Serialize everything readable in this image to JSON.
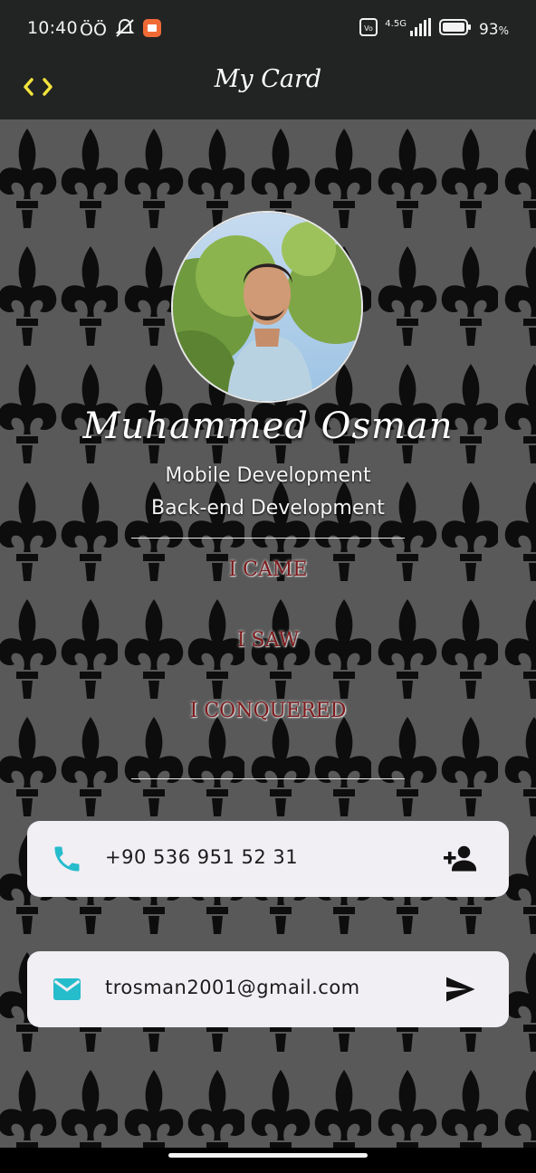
{
  "status_bar": {
    "time": "10:40",
    "left_glyphs": "ÖÖ",
    "network": "4.5G",
    "battery_percent": "93",
    "battery_unit": "%",
    "icons": [
      "mute-bell-icon",
      "app-notification-icon",
      "volte-icon",
      "signal-icon",
      "battery-icon"
    ]
  },
  "app_bar": {
    "title": "My Card",
    "code_icon": "code-icon",
    "code_icon_color": "#f2e33c"
  },
  "profile": {
    "name": "Muhammed Osman",
    "roles": [
      "Mobile Development",
      "Back-end Development"
    ]
  },
  "motto": [
    "I CAME",
    "I SAW",
    "I CONQUERED"
  ],
  "contacts": {
    "phone": {
      "icon": "phone-icon",
      "value": "+90 536 951 52 31",
      "action_icon": "add-person-icon"
    },
    "email": {
      "icon": "mail-icon",
      "value": "trosman2001@gmail.com",
      "action_icon": "send-icon"
    }
  },
  "colors": {
    "bar": "#222323",
    "accent_teal": "#25bccc",
    "motto_red": "#7e1b1d",
    "card_bg": "#f1eef4"
  }
}
